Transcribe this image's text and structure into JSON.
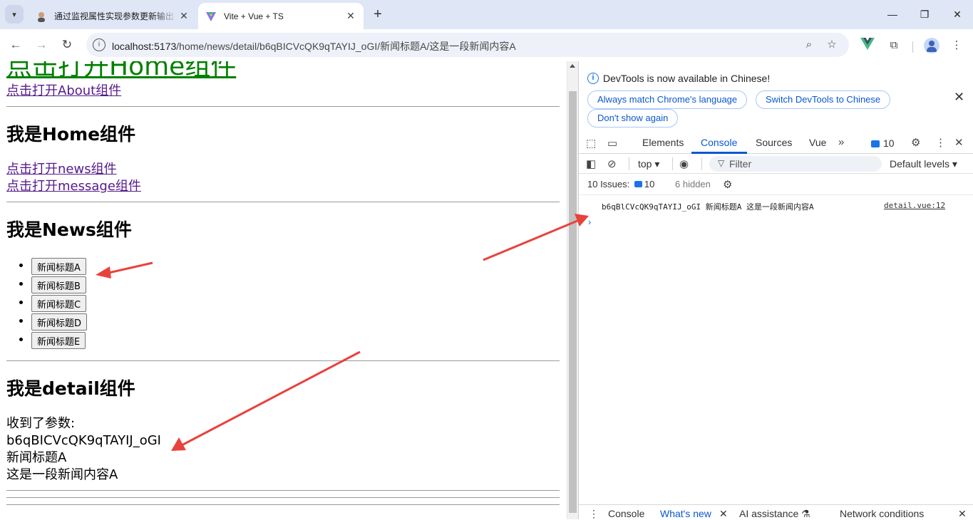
{
  "browser": {
    "tabs": [
      {
        "title": "通过监视属性实现参数更新输出"
      },
      {
        "title": "Vite + Vue + TS"
      }
    ],
    "url_host": "localhost:5173",
    "url_path": "/home/news/detail/b6qBICVcQK9qTAYIJ_oGI/新闻标题A/这是一段新闻内容A"
  },
  "page": {
    "home_link": "点击打开Home组件",
    "about_link": "点击打开About组件",
    "home_heading": "我是Home组件",
    "news_link": "点击打开news组件",
    "message_link": "点击打开message组件",
    "news_heading": "我是News组件",
    "news_items": [
      "新闻标题A",
      "新闻标题B",
      "新闻标题C",
      "新闻标题D",
      "新闻标题E"
    ],
    "detail_heading": "我是detail组件",
    "detail_lines": [
      "收到了参数:",
      "b6qBICVcQK9qTAYIJ_oGI",
      "新闻标题A",
      "这是一段新闻内容A"
    ]
  },
  "devtools": {
    "info_text": "DevTools is now available in Chinese!",
    "btn_match": "Always match Chrome's language",
    "btn_switch": "Switch DevTools to Chinese",
    "btn_dont_show": "Don't show again",
    "tabs": [
      "Elements",
      "Console",
      "Sources",
      "Vue"
    ],
    "active_tab": "Console",
    "issues_count": "10",
    "context": "top",
    "filter_placeholder": "Filter",
    "levels": "Default levels",
    "issues_label": "10 Issues:",
    "hidden_count": "6 hidden",
    "console_message": "b6qBlCVcQK9qTAYIJ_oGI 新闻标题A 这是一段新闻内容A",
    "console_source": "detail.vue:12",
    "drawer_tabs": [
      "Console",
      "What's new",
      "AI assistance",
      "Network conditions"
    ]
  },
  "colors": {
    "accent": "#0b57d0",
    "router_link_active": "#008000",
    "visited_link": "#551a8b",
    "arrow": "#e8423c"
  }
}
